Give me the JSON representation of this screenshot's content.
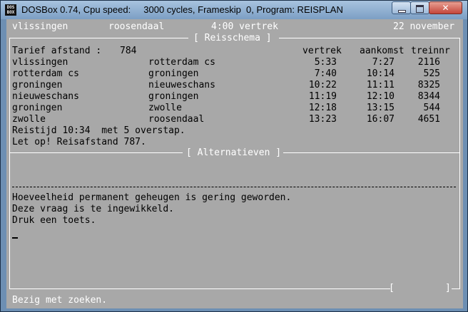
{
  "window": {
    "title": "DOSBox 0.74, Cpu speed:     3000 cycles, Frameskip  0, Program: REISPLAN",
    "icon_text": "DOS BOX",
    "controls": {
      "minimize": "minimize-icon",
      "maximize": "maximize-icon",
      "close": "✕"
    }
  },
  "header": {
    "from": "vlissingen",
    "to": "roosendaal",
    "time": "4:00 vertrek",
    "date": "22 november"
  },
  "reisschema": {
    "title": "[ Reisschema ]",
    "tarief_label": "Tarief afstand :",
    "tarief_value": "784",
    "columns": {
      "vertrek": "vertrek",
      "aankomst": "aankomst",
      "treinnr": "treinnr"
    },
    "rows": [
      {
        "from": "vlissingen",
        "to": "rotterdam cs",
        "vertrek": "5:33",
        "aankomst": "7:27",
        "treinnr": "2116"
      },
      {
        "from": "rotterdam cs",
        "to": "groningen",
        "vertrek": "7:40",
        "aankomst": "10:14",
        "treinnr": "525"
      },
      {
        "from": "groningen",
        "to": "nieuweschans",
        "vertrek": "10:22",
        "aankomst": "11:11",
        "treinnr": "8325"
      },
      {
        "from": "nieuweschans",
        "to": "groningen",
        "vertrek": "11:19",
        "aankomst": "12:10",
        "treinnr": "8344"
      },
      {
        "from": "groningen",
        "to": "zwolle",
        "vertrek": "12:18",
        "aankomst": "13:15",
        "treinnr": "544"
      },
      {
        "from": "zwolle",
        "to": "roosendaal",
        "vertrek": "13:23",
        "aankomst": "16:07",
        "treinnr": "4651"
      }
    ],
    "reistijd": "Reistijd 10:34  met 5 overstap.",
    "let_op": "Let op! Reisafstand 787."
  },
  "alternatieven": {
    "title": "[ Alternatieven ]",
    "messages": [
      "Hoeveelheid permanent geheugen is gering geworden.",
      "Deze vraag is te ingewikkeld.",
      "Druk een toets."
    ],
    "bracket_left": "[",
    "bracket_right": "]"
  },
  "status": "Bezig met zoeken.",
  "colors": {
    "screen_bg": "#a8a8a8",
    "frame": "#ffffff",
    "text": "#000000",
    "status_text": "#ffffff"
  }
}
